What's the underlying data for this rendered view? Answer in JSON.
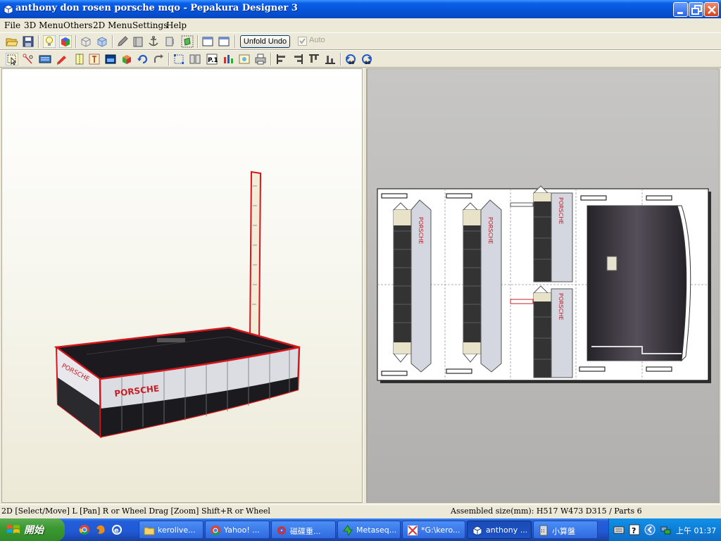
{
  "window": {
    "title": "anthony don rosen porsche mqo - Pepakura Designer 3"
  },
  "menu": {
    "items": [
      "File",
      "3D Menu",
      "Others",
      "2D Menu",
      "Settings",
      "Help"
    ]
  },
  "toolbar1": {
    "unfold_undo_label": "Unfold Undo",
    "auto_label": "Auto",
    "auto_checked": true
  },
  "toolbar2": {
    "rotate_left_label": "90",
    "rotate_right_label": "90"
  },
  "view3d": {
    "model_label": "PORSCHE"
  },
  "view2d": {
    "part_labels": [
      "PORSCHE",
      "PORSCHE",
      "PORSCHE",
      "PORSCHE"
    ]
  },
  "status": {
    "left": "2D [Select/Move] L [Pan] R or Wheel Drag [Zoom] Shift+R or Wheel",
    "right": "Assembled size(mm): H517 W473 D315 / Parts 6"
  },
  "taskbar": {
    "start_label": "開始",
    "tasks": [
      {
        "label": "kerolive...",
        "icon": "folder-icon"
      },
      {
        "label": "Yahoo! ...",
        "icon": "chrome-icon"
      },
      {
        "label": "磁碟重...",
        "icon": "defrag-icon"
      },
      {
        "label": "Metaseq...",
        "icon": "metasequoia-icon"
      },
      {
        "label": "*G:\\kero...",
        "icon": "paint-icon"
      },
      {
        "label": "anthony ...",
        "icon": "pepakura-icon"
      },
      {
        "label": "小算盤",
        "icon": "calculator-icon"
      }
    ],
    "clock": "上午 01:37"
  }
}
